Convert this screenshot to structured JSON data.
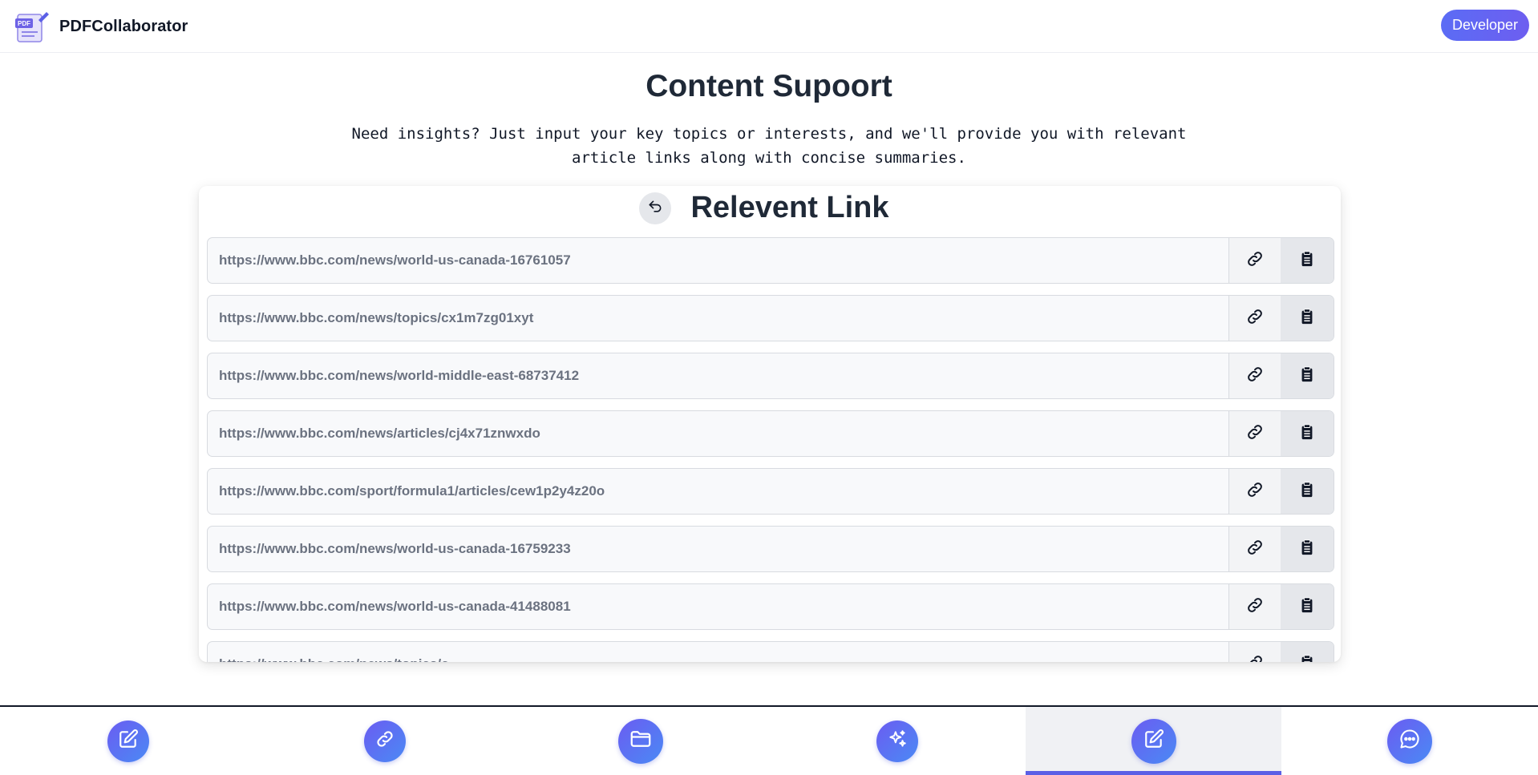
{
  "header": {
    "app_name": "PDFCollaborator",
    "logo_badge": "PDF",
    "developer_label": "Developer",
    "accent": "#5b6cf5"
  },
  "main": {
    "title": "Content Supoort",
    "description": "Need insights? Just input your key topics or interests, and we'll provide you with relevant article links along with concise summaries."
  },
  "card": {
    "title": "Relevent Link",
    "back_icon": "undo-arrow-icon",
    "links": [
      "https://www.bbc.com/news/world-us-canada-16761057",
      "https://www.bbc.com/news/topics/cx1m7zg01xyt",
      "https://www.bbc.com/news/world-middle-east-68737412",
      "https://www.bbc.com/news/articles/cj4x71znwxdo",
      "https://www.bbc.com/sport/formula1/articles/cew1p2y4z20o",
      "https://www.bbc.com/news/world-us-canada-16759233",
      "https://www.bbc.com/news/world-us-canada-41488081",
      "https://www.bbc.com/news/topics/c..."
    ],
    "row_icons": [
      "link-icon",
      "clipboard-icon"
    ]
  },
  "bottom_nav": {
    "items": [
      {
        "icon": "edit-icon"
      },
      {
        "icon": "link-icon"
      },
      {
        "icon": "folder-icon"
      },
      {
        "icon": "sparkles-icon"
      },
      {
        "icon": "edit-icon",
        "active": true
      },
      {
        "icon": "chat-icon"
      }
    ],
    "active_color": "#5b5fe6"
  }
}
